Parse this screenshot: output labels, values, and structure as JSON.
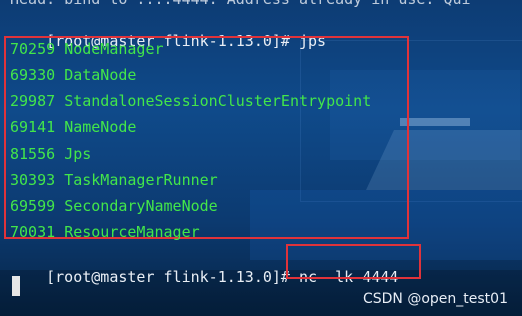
{
  "terminal": {
    "top_partial": "Head: bind to ::::4444: Address already in use. Qui",
    "prompt1": "[root@master flink-1.13.0]# ",
    "cmd1": "jps",
    "processes": [
      {
        "pid": "70259",
        "name": "NodeManager"
      },
      {
        "pid": "69330",
        "name": "DataNode"
      },
      {
        "pid": "29987",
        "name": "StandaloneSessionClusterEntrypoint"
      },
      {
        "pid": "69141",
        "name": "NameNode"
      },
      {
        "pid": "81556",
        "name": "Jps"
      },
      {
        "pid": "30393",
        "name": "TaskManagerRunner"
      },
      {
        "pid": "69599",
        "name": "SecondaryNameNode"
      },
      {
        "pid": "70031",
        "name": "ResourceManager"
      }
    ],
    "prompt2": "[root@master flink-1.13.0]# ",
    "cmd2": "nc -lk 4444"
  },
  "watermark": "CSDN @open_test01",
  "colors": {
    "text_green": "#42e64a",
    "highlight_red": "#e0333a",
    "background": "#0f4a8a"
  }
}
